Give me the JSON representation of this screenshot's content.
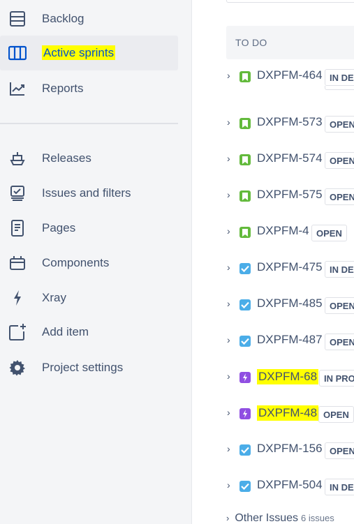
{
  "sidebar": {
    "items": [
      {
        "label": "Backlog",
        "icon": "backlog-icon"
      },
      {
        "label": "Active sprints",
        "icon": "board-icon",
        "active": true,
        "highlighted": true
      },
      {
        "label": "Reports",
        "icon": "reports-icon"
      },
      {
        "label": "Releases",
        "icon": "releases-icon"
      },
      {
        "label": "Issues and filters",
        "icon": "issues-icon"
      },
      {
        "label": "Pages",
        "icon": "pages-icon"
      },
      {
        "label": "Components",
        "icon": "components-icon"
      },
      {
        "label": "Xray",
        "icon": "xray-icon"
      },
      {
        "label": "Add item",
        "icon": "add-item-icon"
      },
      {
        "label": "Project settings",
        "icon": "gear-icon"
      }
    ]
  },
  "board": {
    "column_title": "TO DO",
    "issues": [
      {
        "key": "DXPFM-464",
        "type": "story",
        "status": "IN DE"
      },
      {
        "key": "DXPFM-573",
        "type": "story",
        "status": "OPEN"
      },
      {
        "key": "DXPFM-574",
        "type": "story",
        "status": "OPEN"
      },
      {
        "key": "DXPFM-575",
        "type": "story",
        "status": "OPEN"
      },
      {
        "key": "DXPFM-4",
        "type": "story",
        "status": "OPEN"
      },
      {
        "key": "DXPFM-475",
        "type": "task",
        "status": "IN DE"
      },
      {
        "key": "DXPFM-485",
        "type": "task",
        "status": "OPEN"
      },
      {
        "key": "DXPFM-487",
        "type": "task",
        "status": "OPEN"
      },
      {
        "key": "DXPFM-68",
        "type": "epic",
        "status": "IN PRO",
        "highlighted": true
      },
      {
        "key": "DXPFM-48",
        "type": "epic",
        "status": "OPEN",
        "highlighted": true
      },
      {
        "key": "DXPFM-156",
        "type": "task",
        "status": "OPEN"
      },
      {
        "key": "DXPFM-504",
        "type": "task",
        "status": "IN DE"
      }
    ],
    "other_issues_label": "Other Issues",
    "other_issues_count": "6 issues"
  },
  "colors": {
    "sidebar_bg": "#f4f5f7",
    "active_text": "#0052cc",
    "highlight": "#ffff00",
    "story": "#63ba3c",
    "task": "#4bade8",
    "epic": "#904ee2"
  }
}
